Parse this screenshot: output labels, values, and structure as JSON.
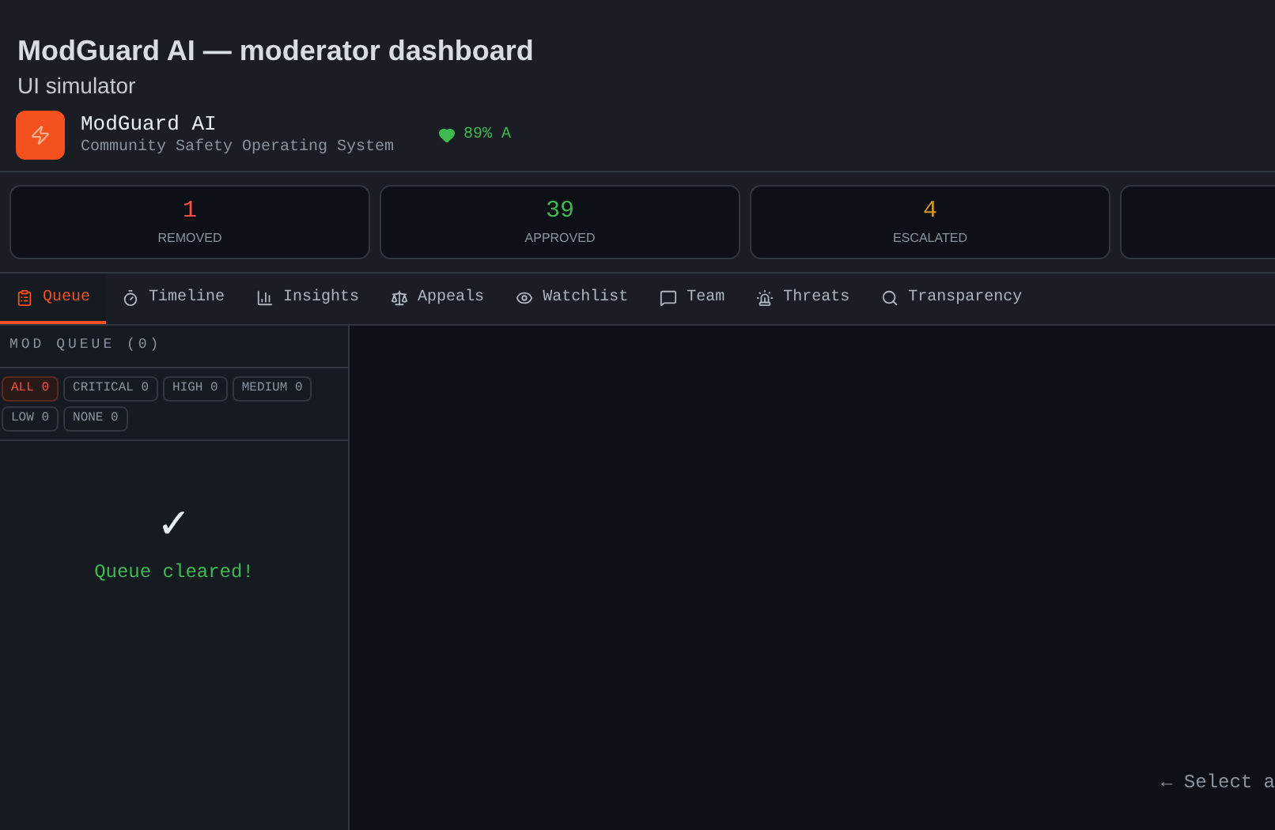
{
  "page": {
    "title": "ModGuard AI — moderator dashboard",
    "subtitle": "UI simulator"
  },
  "brand": {
    "name": "ModGuard AI",
    "tagline": "Community Safety Operating System",
    "health": "89% A"
  },
  "stats": [
    {
      "value": "1",
      "label": "REMOVED",
      "color": "#f85149"
    },
    {
      "value": "39",
      "label": "APPROVED",
      "color": "#3fb950"
    },
    {
      "value": "4",
      "label": "ESCALATED",
      "color": "#d29922"
    }
  ],
  "tabs": [
    {
      "label": "Queue",
      "selected": true
    },
    {
      "label": "Timeline",
      "selected": false
    },
    {
      "label": "Insights",
      "selected": false
    },
    {
      "label": "Appeals",
      "selected": false
    },
    {
      "label": "Watchlist",
      "selected": false
    },
    {
      "label": "Team",
      "selected": false
    },
    {
      "label": "Threats",
      "selected": false
    },
    {
      "label": "Transparency",
      "selected": false
    }
  ],
  "queue": {
    "title": "MOD QUEUE (0)",
    "filters": [
      {
        "label": "ALL 0",
        "selected": true
      },
      {
        "label": "CRITICAL 0",
        "selected": false
      },
      {
        "label": "HIGH 0",
        "selected": false
      },
      {
        "label": "MEDIUM 0",
        "selected": false
      },
      {
        "label": "LOW 0",
        "selected": false
      },
      {
        "label": "NONE 0",
        "selected": false
      }
    ],
    "empty_icon": "✓",
    "empty_text": "Queue cleared!"
  },
  "detail": {
    "hint": "← Select a"
  }
}
